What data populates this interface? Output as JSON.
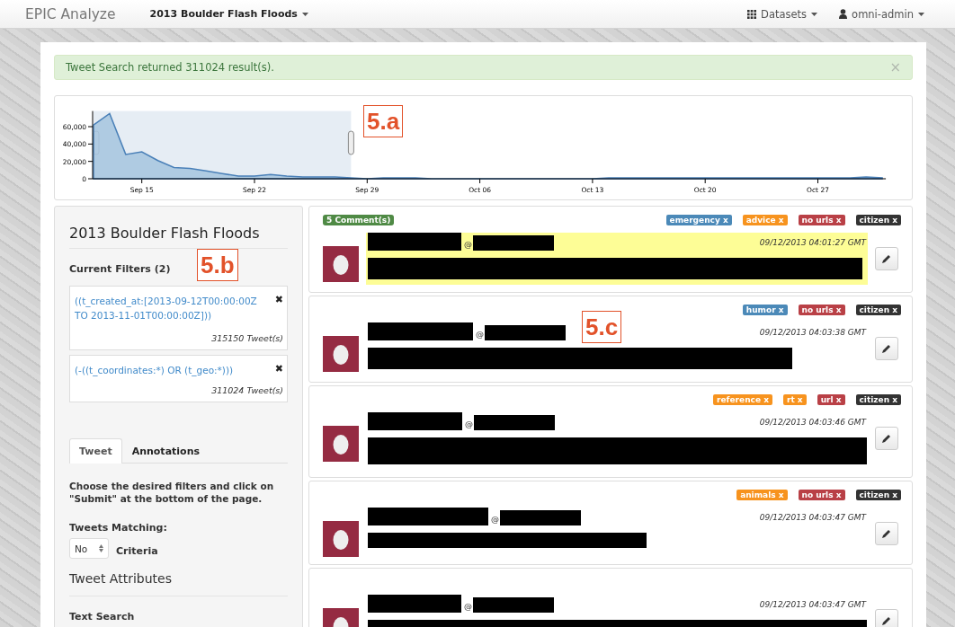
{
  "navbar": {
    "brand": "EPIC Analyze",
    "event_menu": "2013 Boulder Flash Floods",
    "datasets_menu": "Datasets",
    "user_menu": "omni-admin"
  },
  "alert": {
    "message": "Tweet Search returned 311024 result(s).",
    "close": "×"
  },
  "timeline": {
    "chart_data": {
      "type": "area",
      "categories": [
        null,
        null,
        null,
        "Sep 15",
        null,
        null,
        null,
        null,
        null,
        null,
        "Sep 22",
        null,
        null,
        null,
        null,
        null,
        null,
        "Sep 29",
        null,
        null,
        null,
        null,
        null,
        null,
        "Oct 06",
        null,
        null,
        null,
        null,
        null,
        null,
        "Oct 13",
        null,
        null,
        null,
        null,
        null,
        null,
        "Oct 20",
        null,
        null,
        null,
        null,
        null,
        null,
        "Oct 27",
        null,
        null,
        null,
        null
      ],
      "values": [
        62000,
        75000,
        28000,
        31000,
        21000,
        13000,
        12000,
        9000,
        6000,
        3000,
        3000,
        5000,
        3000,
        2000,
        2000,
        2000,
        1000,
        0,
        1000,
        1000,
        1000,
        0,
        0,
        0,
        0,
        0,
        0,
        0,
        0,
        0,
        0,
        0,
        1000,
        1000,
        1000,
        1000,
        1000,
        1000,
        1000,
        1000,
        1000,
        1000,
        1000,
        1000,
        1000,
        1000,
        1000,
        1000,
        2000,
        1000
      ],
      "ylim": [
        0,
        78000
      ],
      "yticks": [
        {
          "value": 0,
          "label": "0"
        },
        {
          "value": 20000,
          "label": "20,000"
        },
        {
          "value": 40000,
          "label": "40,000"
        },
        {
          "value": 60000,
          "label": "60,000"
        }
      ]
    }
  },
  "sidebar": {
    "title": "2013 Boulder Flash Floods",
    "filters_heading": "Current Filters (2)",
    "filters": [
      {
        "query": "((t_created_at:[2013-09-12T00:00:00Z TO 2013-11-01T00:00:00Z]))",
        "remove": "✖",
        "count": "315150 Tweet(s)"
      },
      {
        "query": "(-((t_coordinates:*) OR (t_geo:*)))",
        "remove": "✖",
        "count": "311024 Tweet(s)"
      }
    ],
    "tabs": [
      {
        "label": "Tweet",
        "selected": true
      },
      {
        "label": "Annotations",
        "selected": false
      }
    ],
    "instructions": "Choose the desired filters and click on \"Submit\" at the bottom of the page.",
    "matching_label": "Tweets Matching:",
    "matching_select": {
      "value": "No"
    },
    "criteria_label": "Criteria",
    "attributes_heading": "Tweet Attributes",
    "text_search_label": "Text Search"
  },
  "tweets": [
    {
      "comments": "5 Comment(s)",
      "highlighted": true,
      "at_sign": "@",
      "timestamp": "09/12/2013 04:01:27 GMT",
      "tags": [
        {
          "label": "emergency x",
          "color": "#4b89b8"
        },
        {
          "label": "advice x",
          "color": "#f7931e"
        },
        {
          "label": "no urls x",
          "color": "#b94046"
        },
        {
          "label": "citizen x",
          "color": "#333333"
        }
      ]
    },
    {
      "highlighted": false,
      "at_sign": "@",
      "timestamp": "09/12/2013 04:03:38 GMT",
      "tags": [
        {
          "label": "humor x",
          "color": "#4b89b8"
        },
        {
          "label": "no urls x",
          "color": "#b94046"
        },
        {
          "label": "citizen x",
          "color": "#333333"
        }
      ]
    },
    {
      "highlighted": false,
      "at_sign": "@",
      "timestamp": "09/12/2013 04:03:46 GMT",
      "tags": [
        {
          "label": "reference x",
          "color": "#f7931e"
        },
        {
          "label": "rt x",
          "color": "#f7931e"
        },
        {
          "label": "url x",
          "color": "#b94046"
        },
        {
          "label": "citizen x",
          "color": "#333333"
        }
      ]
    },
    {
      "highlighted": false,
      "at_sign": "@",
      "timestamp": "09/12/2013 04:03:47 GMT",
      "tags": [
        {
          "label": "animals x",
          "color": "#f7931e"
        },
        {
          "label": "no urls x",
          "color": "#b94046"
        },
        {
          "label": "citizen x",
          "color": "#333333"
        }
      ]
    },
    {
      "highlighted": false,
      "at_sign": "@",
      "timestamp": "09/12/2013 04:03:47 GMT"
    }
  ],
  "callouts": [
    {
      "label": "5.a"
    },
    {
      "label": "5.b"
    },
    {
      "label": "5.c"
    }
  ]
}
